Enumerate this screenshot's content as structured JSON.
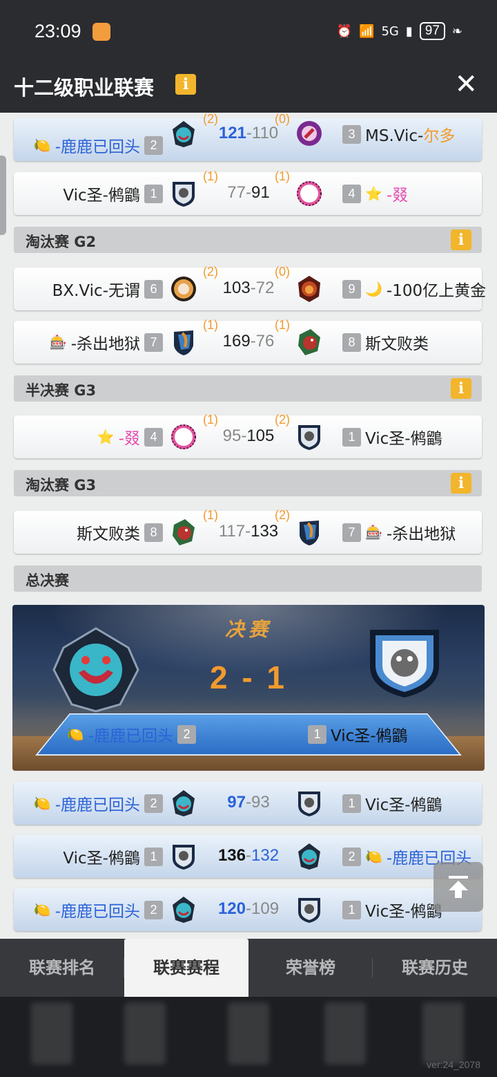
{
  "status": {
    "time": "23:09",
    "network": "5G",
    "battery": "97"
  },
  "header": {
    "title": "十二级职业联赛",
    "info": "i",
    "close": "✕"
  },
  "colors": {
    "accent_orange": "#f29a2e",
    "link_blue": "#2b62d8",
    "pink": "#e64bb0",
    "info_yellow": "#f2b52c"
  },
  "rows_top": [
    {
      "left": {
        "icon": "🍋",
        "prefix": "-",
        "name": "鹿鹿已回头",
        "seed": "2"
      },
      "gl": "(2)",
      "gr": "(0)",
      "s1": "121",
      "s2": "110",
      "right": {
        "seed": "3",
        "name": "MS.Vic-",
        "name2": "尔多"
      }
    },
    {
      "left": {
        "name": "Vic圣-鸺鶹",
        "seed": "1"
      },
      "gl": "(1)",
      "gr": "(1)",
      "s1": "77",
      "s2": "91",
      "right": {
        "seed": "4",
        "icon": "⭐",
        "prefix": "-",
        "name": "叕"
      }
    }
  ],
  "sections": {
    "elim_g2": "淘汰赛 G2",
    "semi_g3": "半决赛 G3",
    "elim_g3": "淘汰赛 G3",
    "finals": "总决赛",
    "info": "i"
  },
  "elim_g2": [
    {
      "left": {
        "name": "BX.Vic-无谓",
        "seed": "6"
      },
      "gl": "(2)",
      "gr": "(0)",
      "s1": "103",
      "s2": "72",
      "right": {
        "seed": "9",
        "icon": "🌙",
        "name": "-100亿上黄金"
      }
    },
    {
      "left": {
        "icon": "🎰",
        "name": "-杀出地狱",
        "seed": "7"
      },
      "gl": "(1)",
      "gr": "(1)",
      "s1": "169",
      "s2": "76",
      "right": {
        "seed": "8",
        "name": "斯文败类"
      }
    }
  ],
  "semi_g3": [
    {
      "left": {
        "icon": "⭐",
        "prefix": "-",
        "name": "叕",
        "seed": "4"
      },
      "gl": "(1)",
      "gr": "(2)",
      "s1": "95",
      "s2": "105",
      "right": {
        "seed": "1",
        "name": "Vic圣-鸺鶹"
      }
    }
  ],
  "elim_g3": [
    {
      "left": {
        "name": "斯文败类",
        "seed": "8"
      },
      "gl": "(1)",
      "gr": "(2)",
      "s1": "117",
      "s2": "133",
      "right": {
        "seed": "7",
        "icon": "🎰",
        "name": "-杀出地狱"
      }
    }
  ],
  "final": {
    "title": "决赛",
    "score": "2 - 1",
    "left": {
      "icon": "🍋",
      "name": "-鹿鹿已回头",
      "seed": "2"
    },
    "right": {
      "seed": "1",
      "name": "Vic圣-鸺鶹"
    }
  },
  "final_games": [
    {
      "left": {
        "icon": "🍋",
        "name": "-鹿鹿已回头",
        "seed": "2"
      },
      "s1": "97",
      "s2": "93",
      "right": {
        "seed": "1",
        "name": "Vic圣-鸺鶹"
      }
    },
    {
      "left": {
        "name": "Vic圣-鸺鶹",
        "seed": "1"
      },
      "s1": "136",
      "s2": "132",
      "right": {
        "seed": "2",
        "icon": "🍋",
        "name": "-鹿鹿已回头"
      }
    },
    {
      "left": {
        "icon": "🍋",
        "name": "-鹿鹿已回头",
        "seed": "2"
      },
      "s1": "120",
      "s2": "109",
      "right": {
        "seed": "1",
        "name": "Vic圣-鸺鶹"
      }
    }
  ],
  "tabs": [
    "联赛排名",
    "联赛赛程",
    "荣誉榜",
    "联赛历史"
  ],
  "version": "ver:24_2078"
}
